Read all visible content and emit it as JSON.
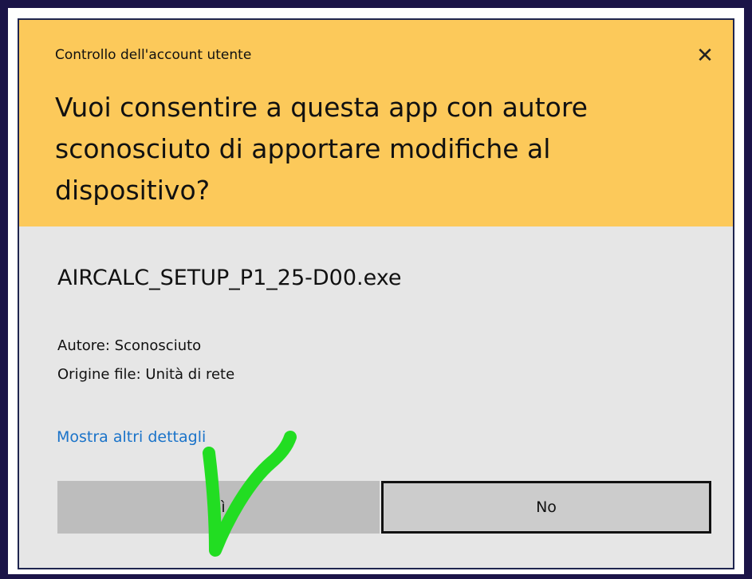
{
  "dialog": {
    "title": "Controllo dell'account utente",
    "close_glyph": "✕",
    "question": "Vuoi consentire a questa app con autore sconosciuto di apportare modifiche al dispositivo?",
    "filename": "AIRCALC_SETUP_P1_25-D00.exe",
    "author": "Autore: Sconosciuto",
    "origin": "Origine file: Unità di rete",
    "details_link": "Mostra altri dettagli",
    "buttons": {
      "yes": "Sì",
      "no": "No"
    }
  },
  "colors": {
    "header_bg": "#fcc95a",
    "body_bg": "#e6e6e6",
    "link": "#1a73c9",
    "frame": "#1b1448",
    "annotation": "#22dd22"
  },
  "annotation": {
    "icon": "green-checkmark-icon"
  }
}
